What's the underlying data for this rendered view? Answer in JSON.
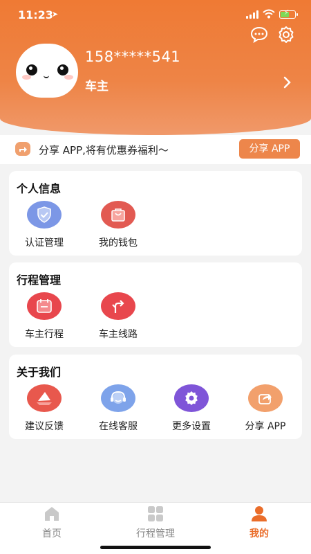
{
  "status_bar": {
    "time": "11:23",
    "location_glyph": "➤"
  },
  "profile": {
    "phone": "158*****541",
    "role": "车主"
  },
  "share_banner": {
    "text": "分享 APP,将有优惠券福利～",
    "button": "分享 APP"
  },
  "sections": [
    {
      "title": "个人信息",
      "items": [
        {
          "label": "认证管理",
          "icon": "shield-check-icon",
          "color": "#7c97e6"
        },
        {
          "label": "我的钱包",
          "icon": "wallet-bag-icon",
          "color": "#e25a52"
        }
      ]
    },
    {
      "title": "行程管理",
      "items": [
        {
          "label": "车主行程",
          "icon": "calendar-icon",
          "color": "#e8474d"
        },
        {
          "label": "车主线路",
          "icon": "route-arrow-icon",
          "color": "#e8474d"
        }
      ]
    },
    {
      "title": "关于我们",
      "items": [
        {
          "label": "建议反馈",
          "icon": "feedback-sail-icon",
          "color": "#e8584d"
        },
        {
          "label": "在线客服",
          "icon": "headset-icon",
          "color": "#7ea3ea"
        },
        {
          "label": "更多设置",
          "icon": "gear-icon",
          "color": "#7f55d8"
        },
        {
          "label": "分享 APP",
          "icon": "share-icon",
          "color": "#f2a06c"
        }
      ]
    }
  ],
  "bottom_nav": [
    {
      "label": "首页",
      "icon": "home-icon",
      "active": false
    },
    {
      "label": "行程管理",
      "icon": "grid-icon",
      "active": false
    },
    {
      "label": "我的",
      "icon": "person-icon",
      "active": true
    }
  ],
  "colors": {
    "accent": "#ee7a35",
    "active_tab": "#ea6d2a"
  }
}
